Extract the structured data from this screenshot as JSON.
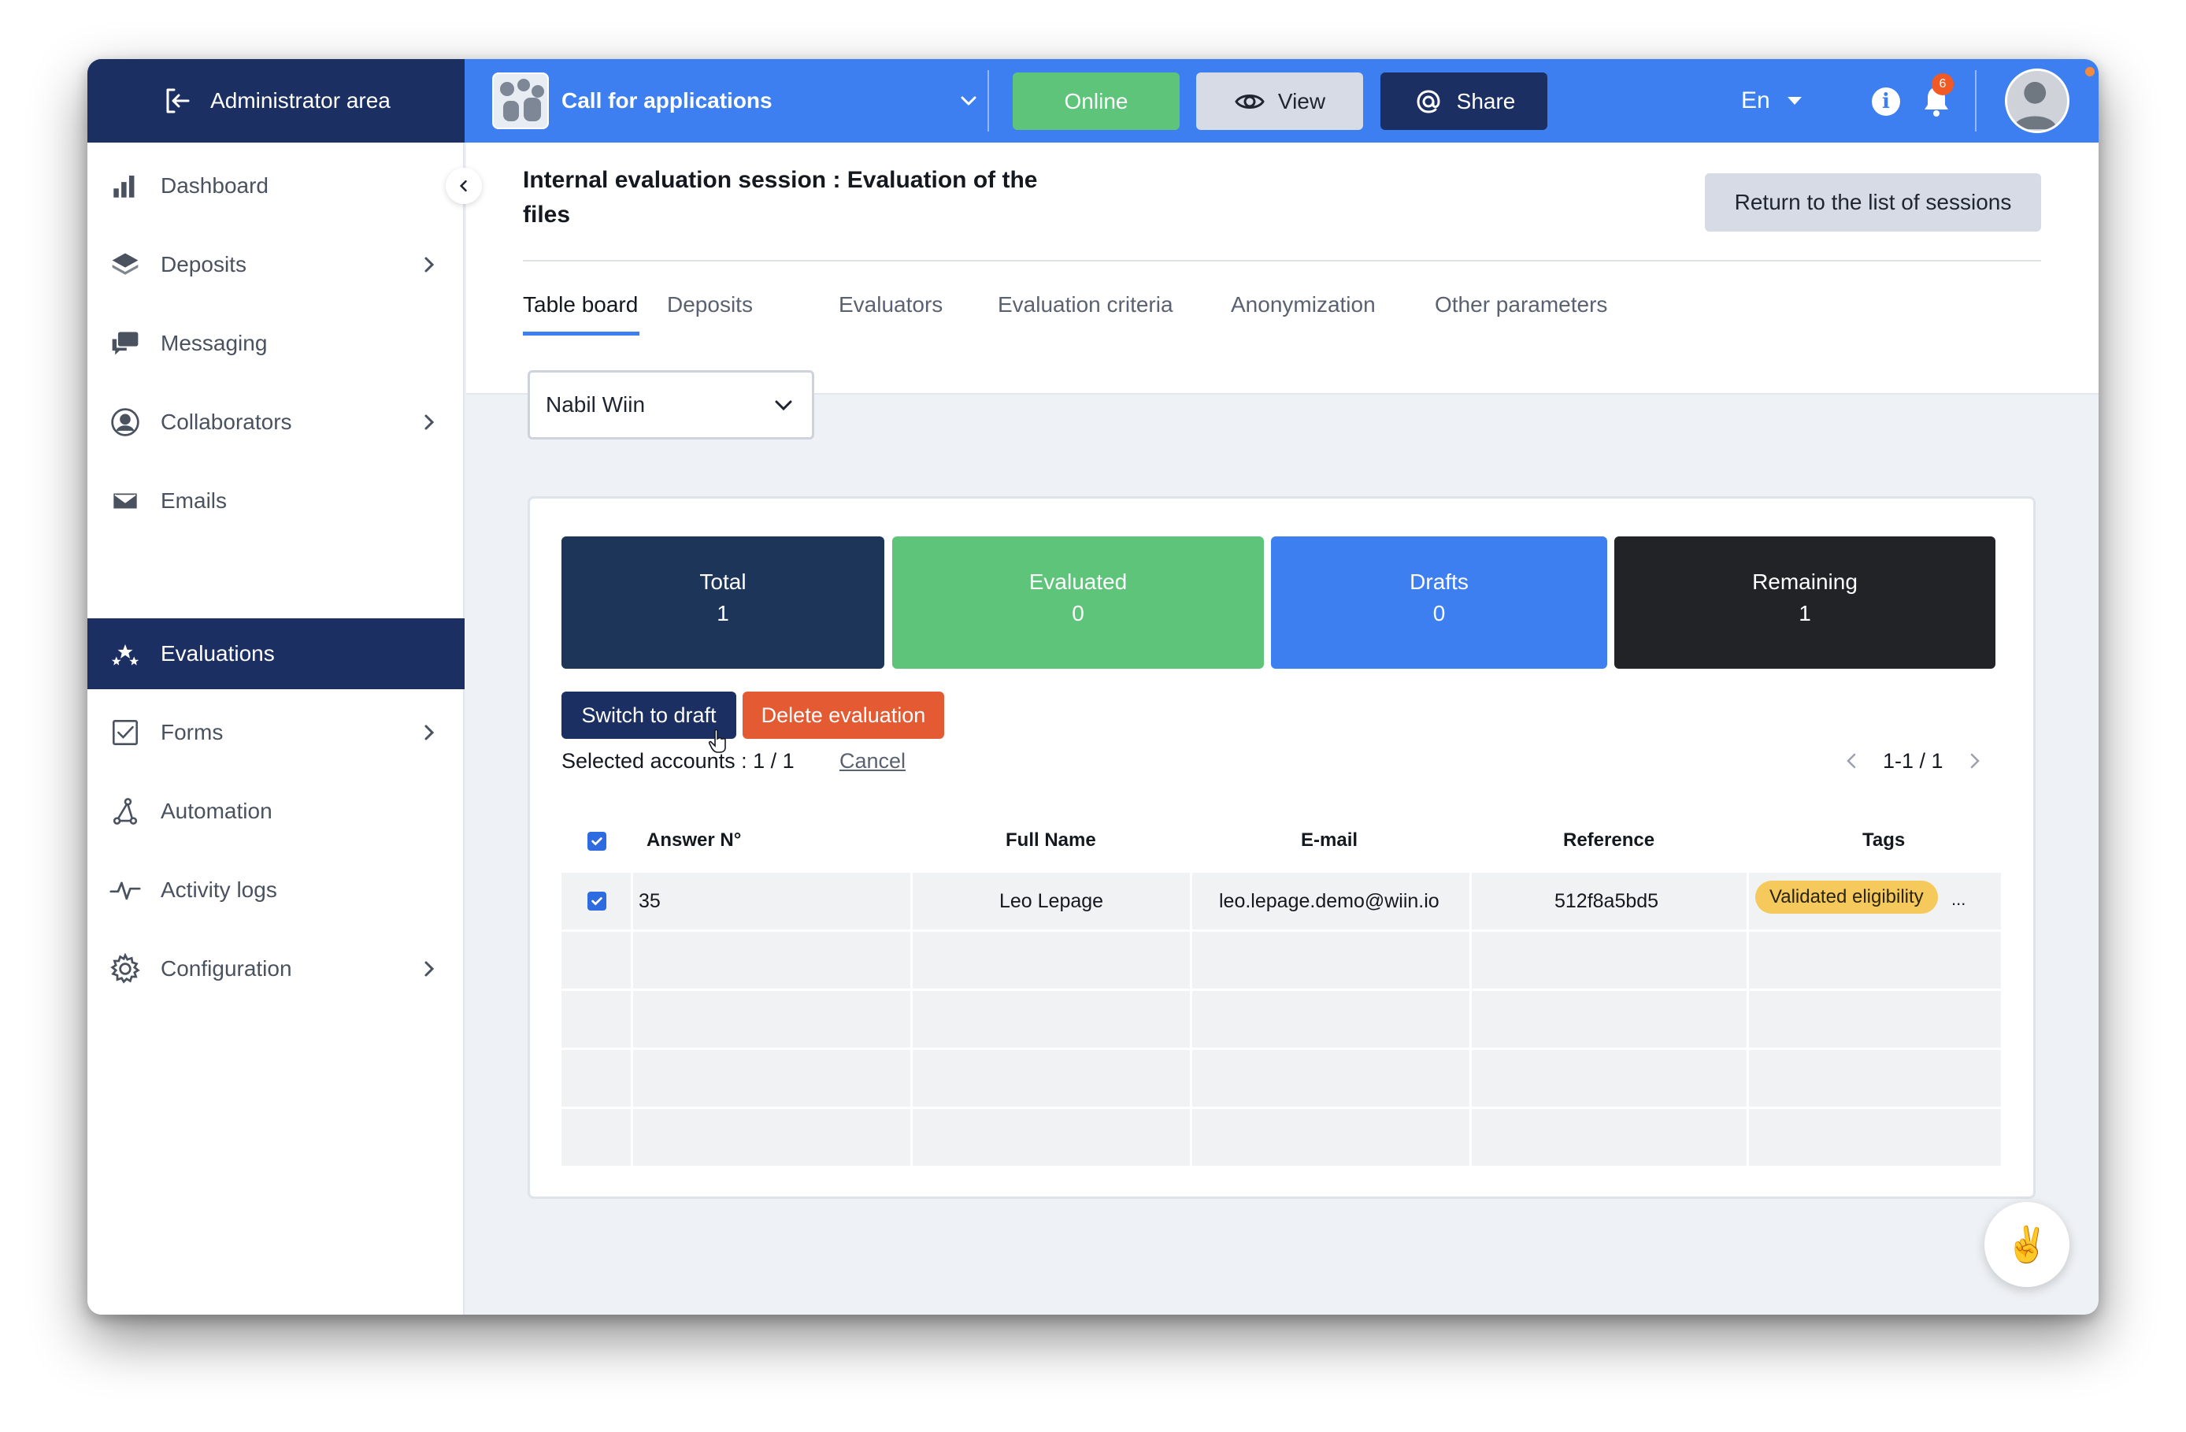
{
  "topbar": {
    "admin_area_label": "Administrator area",
    "app_title": "Call for applications",
    "online_label": "Online",
    "view_label": "View",
    "share_label": "Share",
    "language": "En",
    "notification_count": "6"
  },
  "sidebar": {
    "items": [
      {
        "label": "Dashboard",
        "icon": "bar-chart-icon",
        "has_submenu": false
      },
      {
        "label": "Deposits",
        "icon": "layers-icon",
        "has_submenu": true
      },
      {
        "label": "Messaging",
        "icon": "chat-icon",
        "has_submenu": false
      },
      {
        "label": "Collaborators",
        "icon": "user-circle-icon",
        "has_submenu": true
      },
      {
        "label": "Emails",
        "icon": "envelope-icon",
        "has_submenu": false
      },
      {
        "label": "Evaluations",
        "icon": "stars-icon",
        "has_submenu": false,
        "active": true
      },
      {
        "label": "Forms",
        "icon": "checkbox-icon",
        "has_submenu": true
      },
      {
        "label": "Automation",
        "icon": "automation-icon",
        "has_submenu": false
      },
      {
        "label": "Activity logs",
        "icon": "pulse-icon",
        "has_submenu": false
      },
      {
        "label": "Configuration",
        "icon": "gear-icon",
        "has_submenu": true
      }
    ]
  },
  "header": {
    "title": "Internal evaluation session : Evaluation of the files",
    "return_button": "Return to the list of sessions",
    "tabs": [
      {
        "label": "Table board",
        "active": true
      },
      {
        "label": "Deposits"
      },
      {
        "label": "Evaluators"
      },
      {
        "label": "Evaluation criteria"
      },
      {
        "label": "Anonymization"
      },
      {
        "label": "Other parameters"
      }
    ]
  },
  "evaluator_select": {
    "value": "Nabil Wiin"
  },
  "stats": {
    "total": {
      "label": "Total",
      "value": "1"
    },
    "evaluated": {
      "label": "Evaluated",
      "value": "0"
    },
    "drafts": {
      "label": "Drafts",
      "value": "0"
    },
    "remaining": {
      "label": "Remaining",
      "value": "1"
    }
  },
  "actions": {
    "switch_to_draft": "Switch to draft",
    "delete_evaluation": "Delete evaluation",
    "selected_accounts": "Selected accounts : 1 / 1",
    "cancel": "Cancel",
    "pagination": "1-1 / 1"
  },
  "table": {
    "columns": [
      "Answer N°",
      "Full Name",
      "E-mail",
      "Reference",
      "Tags"
    ],
    "rows": [
      {
        "checked": true,
        "answer": "35",
        "full_name": "Leo Lepage",
        "email": "leo.lepage.demo@wiin.io",
        "reference": "512f8a5bd5",
        "tag": "Validated eligibility",
        "more": "..."
      }
    ]
  },
  "colors": {
    "brand_blue": "#3d7ff0",
    "navy": "#1c2f62",
    "green": "#5ec47a",
    "orange": "#e35a33",
    "tag_yellow": "#f5c95c"
  }
}
